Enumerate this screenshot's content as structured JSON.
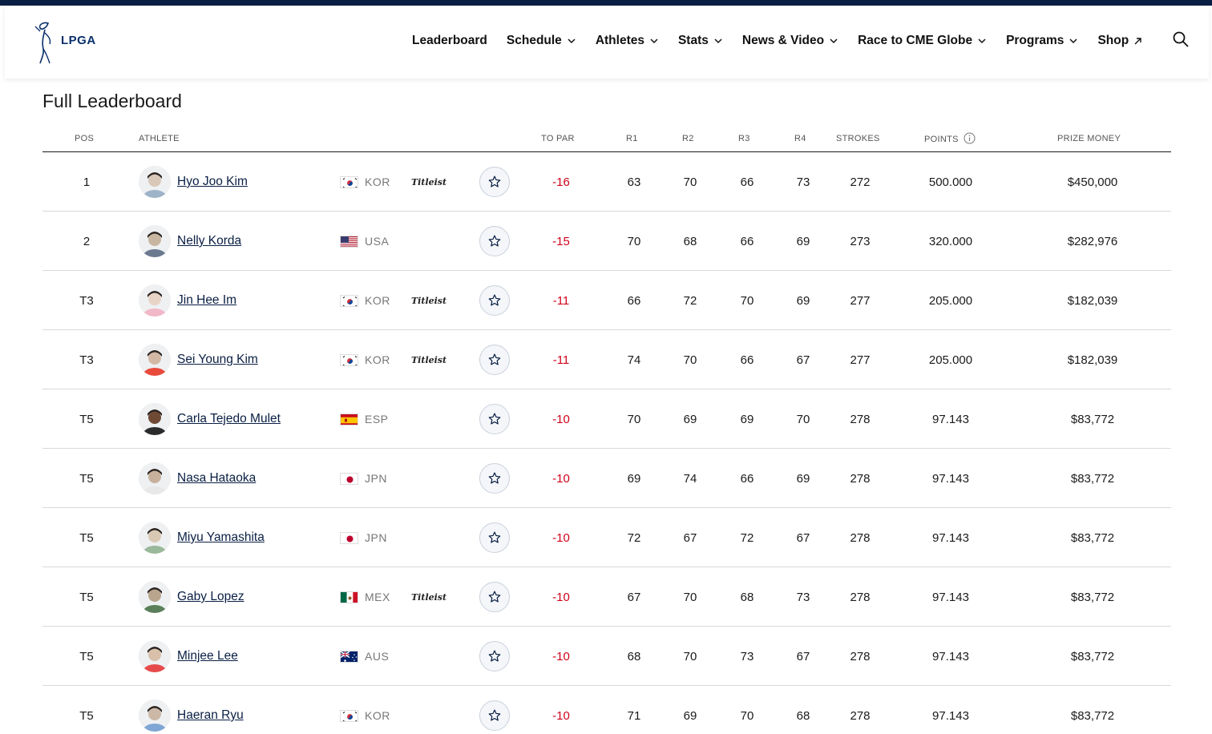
{
  "header": {
    "logo_text": "LPGA",
    "nav": [
      {
        "label": "Leaderboard",
        "dropdown": false,
        "external": false
      },
      {
        "label": "Schedule",
        "dropdown": true,
        "external": false
      },
      {
        "label": "Athletes",
        "dropdown": true,
        "external": false
      },
      {
        "label": "Stats",
        "dropdown": true,
        "external": false
      },
      {
        "label": "News & Video",
        "dropdown": true,
        "external": false
      },
      {
        "label": "Race to CME Globe",
        "dropdown": true,
        "external": false
      },
      {
        "label": "Programs",
        "dropdown": true,
        "external": false
      },
      {
        "label": "Shop",
        "dropdown": false,
        "external": true
      }
    ]
  },
  "page_title": "Full Leaderboard",
  "columns": {
    "pos": "POS",
    "athlete": "ATHLETE",
    "to_par": "TO PAR",
    "r1": "R1",
    "r2": "R2",
    "r3": "R3",
    "r4": "R4",
    "strokes": "STROKES",
    "points": "POINTS",
    "prize": "PRIZE MONEY"
  },
  "colors": {
    "brand_navy": "#0a1f44",
    "under_par_red": "#d0021b"
  },
  "rows": [
    {
      "pos": "1",
      "name": "Hyo Joo Kim",
      "country": "KOR",
      "sponsor": "Titleist",
      "to_par": "-16",
      "r1": "63",
      "r2": "70",
      "r3": "66",
      "r4": "73",
      "strokes": "272",
      "points": "500.000",
      "prize": "$450,000"
    },
    {
      "pos": "2",
      "name": "Nelly Korda",
      "country": "USA",
      "sponsor": "",
      "to_par": "-15",
      "r1": "70",
      "r2": "68",
      "r3": "66",
      "r4": "69",
      "strokes": "273",
      "points": "320.000",
      "prize": "$282,976"
    },
    {
      "pos": "T3",
      "name": "Jin Hee Im",
      "country": "KOR",
      "sponsor": "Titleist",
      "to_par": "-11",
      "r1": "66",
      "r2": "72",
      "r3": "70",
      "r4": "69",
      "strokes": "277",
      "points": "205.000",
      "prize": "$182,039"
    },
    {
      "pos": "T3",
      "name": "Sei Young Kim",
      "country": "KOR",
      "sponsor": "Titleist",
      "to_par": "-11",
      "r1": "74",
      "r2": "70",
      "r3": "66",
      "r4": "67",
      "strokes": "277",
      "points": "205.000",
      "prize": "$182,039"
    },
    {
      "pos": "T5",
      "name": "Carla Tejedo Mulet",
      "country": "ESP",
      "sponsor": "",
      "to_par": "-10",
      "r1": "70",
      "r2": "69",
      "r3": "69",
      "r4": "70",
      "strokes": "278",
      "points": "97.143",
      "prize": "$83,772"
    },
    {
      "pos": "T5",
      "name": "Nasa Hataoka",
      "country": "JPN",
      "sponsor": "",
      "to_par": "-10",
      "r1": "69",
      "r2": "74",
      "r3": "66",
      "r4": "69",
      "strokes": "278",
      "points": "97.143",
      "prize": "$83,772"
    },
    {
      "pos": "T5",
      "name": "Miyu Yamashita",
      "country": "JPN",
      "sponsor": "",
      "to_par": "-10",
      "r1": "72",
      "r2": "67",
      "r3": "72",
      "r4": "67",
      "strokes": "278",
      "points": "97.143",
      "prize": "$83,772"
    },
    {
      "pos": "T5",
      "name": "Gaby Lopez",
      "country": "MEX",
      "sponsor": "Titleist",
      "to_par": "-10",
      "r1": "67",
      "r2": "70",
      "r3": "68",
      "r4": "73",
      "strokes": "278",
      "points": "97.143",
      "prize": "$83,772"
    },
    {
      "pos": "T5",
      "name": "Minjee Lee",
      "country": "AUS",
      "sponsor": "",
      "to_par": "-10",
      "r1": "68",
      "r2": "70",
      "r3": "73",
      "r4": "67",
      "strokes": "278",
      "points": "97.143",
      "prize": "$83,772"
    },
    {
      "pos": "T5",
      "name": "Haeran Ryu",
      "country": "KOR",
      "sponsor": "",
      "to_par": "-10",
      "r1": "71",
      "r2": "69",
      "r3": "70",
      "r4": "68",
      "strokes": "278",
      "points": "97.143",
      "prize": "$83,772"
    }
  ]
}
